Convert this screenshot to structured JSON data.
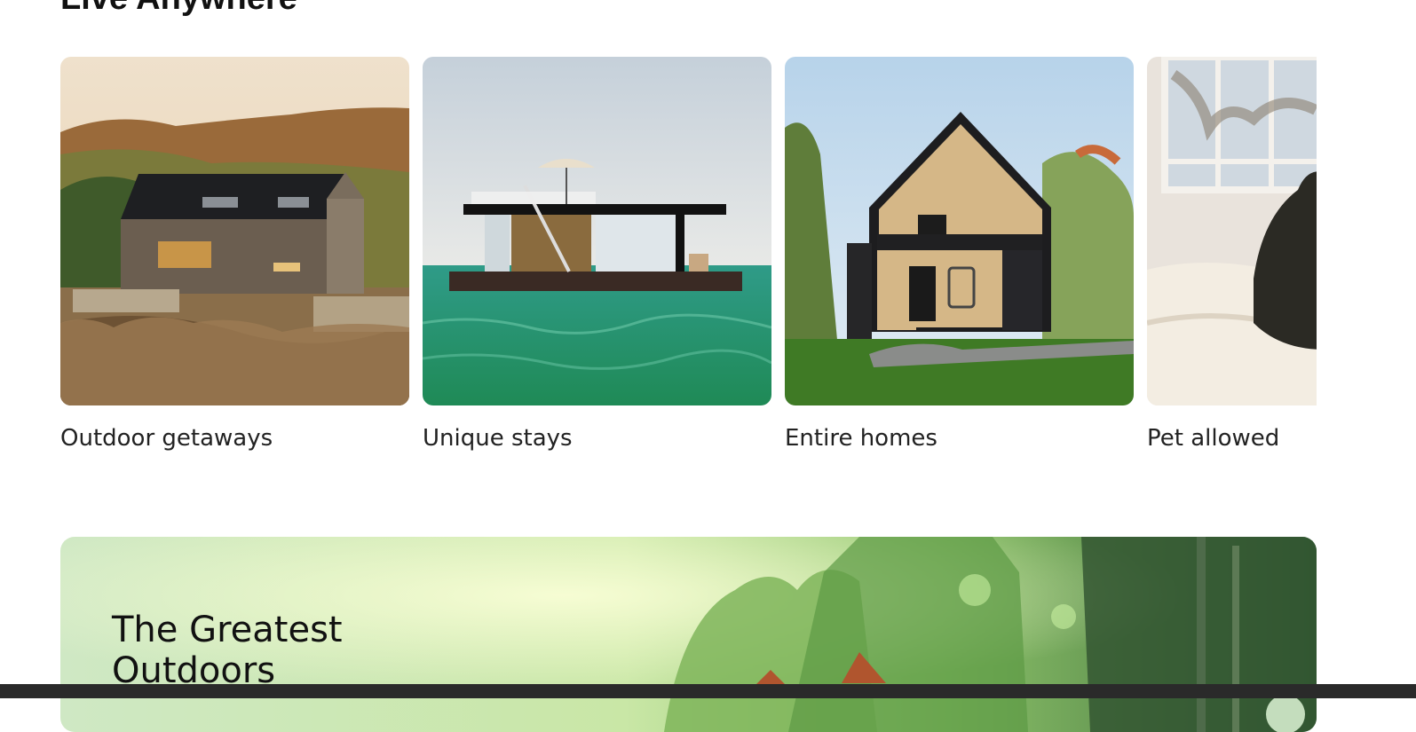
{
  "section": {
    "title": "Live Anywhere"
  },
  "cards": [
    {
      "label": "Outdoor getaways",
      "image": "stone-cabin-hillside-photo"
    },
    {
      "label": "Unique stays",
      "image": "floating-houseboat-photo"
    },
    {
      "label": "Entire homes",
      "image": "wooden-a-frame-house-photo"
    },
    {
      "label": "Pet allowed",
      "image": "dog-on-bed-photo"
    }
  ],
  "banner": {
    "title": "The Greatest Outdoors",
    "image": "illustrated-forest-cabin"
  },
  "colors": {
    "text": "#222222",
    "banner_green": "#9fd98a"
  }
}
